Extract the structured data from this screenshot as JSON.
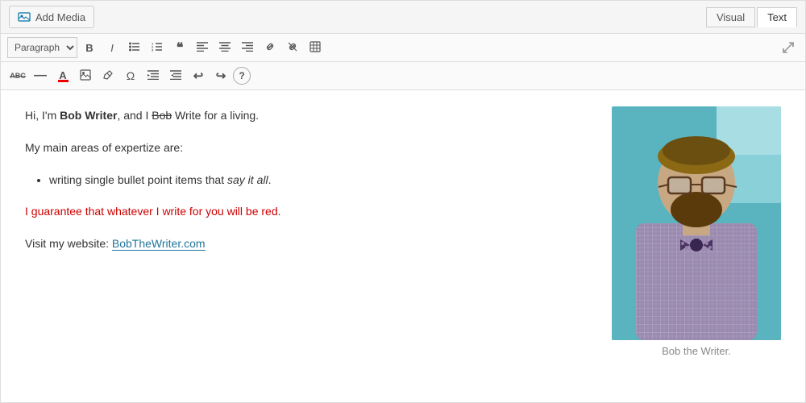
{
  "topBar": {
    "addMediaLabel": "Add Media",
    "tabs": [
      {
        "id": "visual",
        "label": "Visual",
        "active": false
      },
      {
        "id": "text",
        "label": "Text",
        "active": true
      }
    ]
  },
  "toolbar": {
    "paragraphSelect": "Paragraph",
    "buttons": [
      "Bold",
      "Italic",
      "Unordered List",
      "Ordered List",
      "Blockquote",
      "Align Left",
      "Align Center",
      "Align Right",
      "Link",
      "Unlink",
      "Table",
      "Strikethrough",
      "Horizontal Rule",
      "Text Color",
      "Media Library",
      "Eraser",
      "Omega",
      "Indent",
      "Outdent",
      "Undo",
      "Redo",
      "Help"
    ]
  },
  "content": {
    "paragraph1_prefix": "Hi, I'm ",
    "paragraph1_bold": "Bob Writer",
    "paragraph1_suffix1": ", and I ",
    "paragraph1_strikethrough": "Bob",
    "paragraph1_suffix2": " Write for a living.",
    "paragraph2": "My main areas of expertize are:",
    "bullet1_prefix": "writing single bullet point items that ",
    "bullet1_italic": "say it all",
    "bullet1_suffix": ".",
    "paragraph3": "I guarantee that whatever I write for you will be red.",
    "paragraph4_prefix": "Visit my website: ",
    "paragraph4_link": "BobTheWriter.com"
  },
  "sidebar": {
    "caption": "Bob the Writer."
  },
  "colors": {
    "accent": "#0073aa",
    "red": "#cc0000",
    "link": "#21759b"
  }
}
